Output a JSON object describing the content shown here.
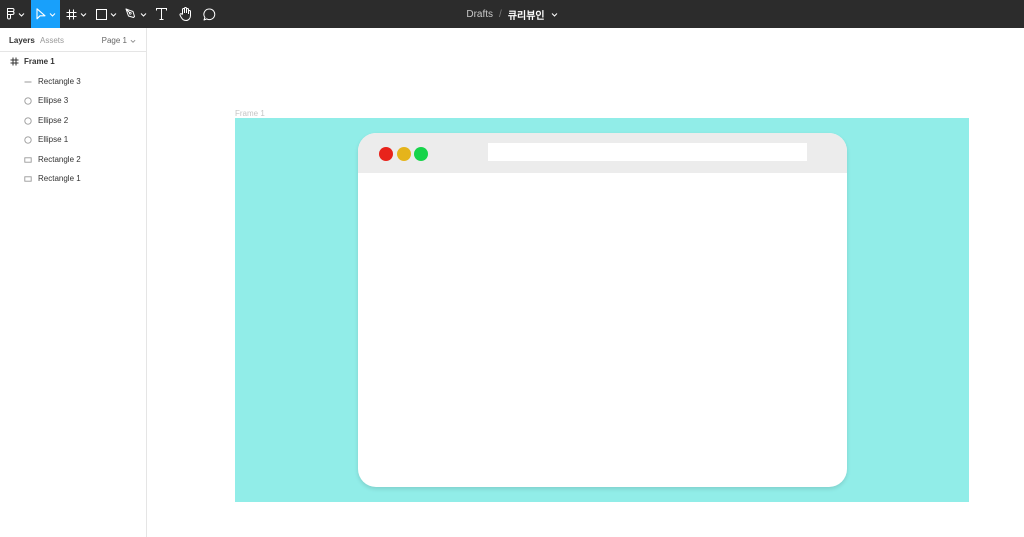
{
  "toolbar": {
    "tools": [
      {
        "icon": "figma-logo-icon",
        "caret": true
      },
      {
        "icon": "move-pointer-icon",
        "caret": true,
        "active": true
      },
      {
        "icon": "frame-hash-icon",
        "caret": true
      },
      {
        "icon": "rectangle-shape-icon",
        "caret": true
      },
      {
        "icon": "pen-tool-icon",
        "caret": true
      },
      {
        "icon": "text-tool-icon",
        "caret": false
      },
      {
        "icon": "hand-tool-icon",
        "caret": false
      },
      {
        "icon": "comment-icon",
        "caret": false
      }
    ],
    "breadcrumb": "Drafts",
    "separator": "/",
    "file_name": "큐리뷰인",
    "active_color": "#18a0fb",
    "bg_color": "#2c2c2c"
  },
  "left_panel": {
    "tabs": {
      "layers": "Layers",
      "assets": "Assets"
    },
    "page": "Page 1",
    "layers": [
      {
        "name": "Frame 1",
        "icon": "frame-hash-icon"
      },
      {
        "name": "Rectangle 3",
        "icon": "line-icon"
      },
      {
        "name": "Ellipse 3",
        "icon": "ellipse-icon"
      },
      {
        "name": "Ellipse 2",
        "icon": "ellipse-icon"
      },
      {
        "name": "Ellipse 1",
        "icon": "ellipse-icon"
      },
      {
        "name": "Rectangle 2",
        "icon": "rectangle-icon"
      },
      {
        "name": "Rectangle 1",
        "icon": "rectangle-icon"
      }
    ]
  },
  "canvas": {
    "frame_label": "Frame 1",
    "frame_color": "#91ede8",
    "window_bar_color": "#ececec",
    "window_color": "#ffffff",
    "traffic_lights": [
      "#e8231b",
      "#e5b41b",
      "#16d44a"
    ]
  }
}
